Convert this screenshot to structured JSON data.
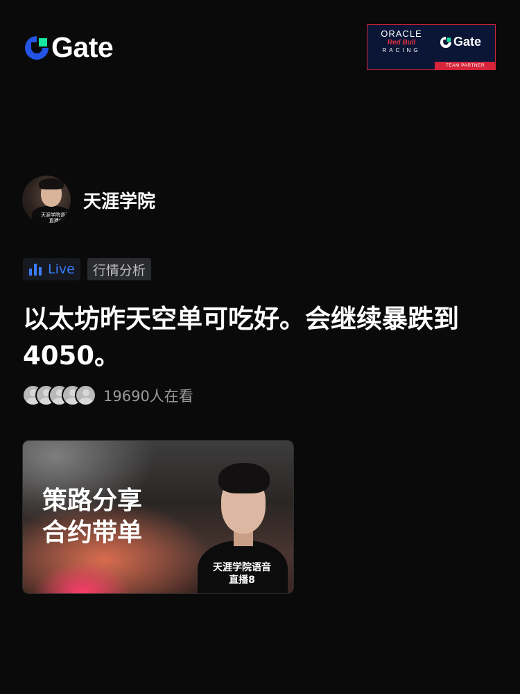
{
  "header": {
    "brand": "Gate",
    "partner": {
      "oracle": "ORACLE",
      "redbull": "Red Bull",
      "racing": "RACING",
      "brand": "Gate",
      "tagline": "TEAM PARTNER"
    }
  },
  "channel": {
    "name": "天涯学院",
    "avatar_caption": "天涯学院语音直播8"
  },
  "tags": {
    "live": "Live",
    "category": "行情分析"
  },
  "stream": {
    "title": "以太坊昨天空单可吃好。会继续暴跌到4050。",
    "viewers": "19690人在看"
  },
  "cover": {
    "headline_line1": "策路分享",
    "headline_line2": "合约带单",
    "caption_line1": "天涯学院语音",
    "caption_line2": "直播8"
  },
  "colors": {
    "background": "#0a0a0a",
    "brand_blue": "#2354e6",
    "brand_green": "#17e6a1",
    "live_blue": "#3a7cff",
    "partner_red": "#d6243a"
  },
  "icons": [
    "gate-logo-icon",
    "live-bars-icon",
    "viewer-avatar-icon"
  ]
}
